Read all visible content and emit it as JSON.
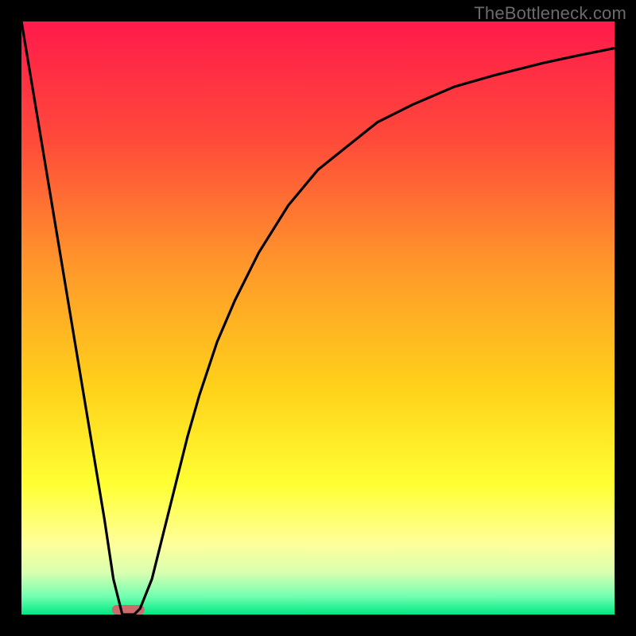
{
  "watermark": "TheBottleneck.com",
  "chart_data": {
    "type": "line",
    "title": "",
    "xlabel": "",
    "ylabel": "",
    "xlim": [
      0,
      100
    ],
    "ylim": [
      0,
      100
    ],
    "background_gradient": {
      "stops": [
        {
          "offset": 0.0,
          "color": "#ff1a4b"
        },
        {
          "offset": 0.2,
          "color": "#ff4a3a"
        },
        {
          "offset": 0.42,
          "color": "#ff9a2a"
        },
        {
          "offset": 0.62,
          "color": "#ffd21a"
        },
        {
          "offset": 0.78,
          "color": "#ffff33"
        },
        {
          "offset": 0.88,
          "color": "#ffff9a"
        },
        {
          "offset": 0.93,
          "color": "#d8ffb0"
        },
        {
          "offset": 0.97,
          "color": "#70ffb0"
        },
        {
          "offset": 1.0,
          "color": "#00e884"
        }
      ]
    },
    "series": [
      {
        "name": "bottleneck-curve",
        "color": "#000000",
        "x": [
          0,
          2,
          4,
          6,
          8,
          10,
          12,
          14,
          15.5,
          17,
          18,
          19,
          20,
          22,
          24,
          26,
          28,
          30,
          33,
          36,
          40,
          45,
          50,
          55,
          60,
          66,
          73,
          80,
          88,
          94,
          100
        ],
        "y": [
          100,
          88,
          76,
          64,
          52,
          40,
          28,
          16,
          6,
          0,
          0,
          0,
          1,
          6,
          14,
          22,
          30,
          37,
          46,
          53,
          61,
          69,
          75,
          79,
          83,
          86,
          89,
          91,
          93,
          94.3,
          95.5
        ]
      }
    ],
    "marker": {
      "name": "minimum-marker",
      "x_center": 18,
      "width": 5.5,
      "color": "#cc6b6b"
    }
  }
}
